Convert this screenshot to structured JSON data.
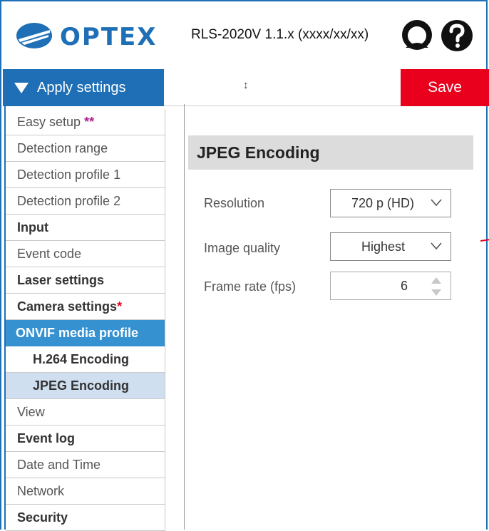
{
  "header": {
    "brand": "OPTEX",
    "version": "RLS-2020V 1.1.x (xxxx/xx/xx)",
    "user_icon": "user-icon",
    "help_icon": "help-icon"
  },
  "toolbar": {
    "apply_label": "Apply settings",
    "resize_glyph": "↕",
    "save_label": "Save"
  },
  "sidebar": {
    "items": [
      {
        "label": "Easy setup",
        "marker": "**"
      },
      {
        "label": "Detection range"
      },
      {
        "label": "Detection profile 1"
      },
      {
        "label": "Detection profile 2"
      },
      {
        "label": "Input"
      },
      {
        "label": "Event code"
      },
      {
        "label": "Laser settings"
      },
      {
        "label": "Camera settings",
        "marker": "*"
      },
      {
        "label": "ONVIF media profile"
      },
      {
        "label": "H.264 Encoding"
      },
      {
        "label": "JPEG Encoding"
      },
      {
        "label": "View"
      },
      {
        "label": "Event log"
      },
      {
        "label": "Date and Time"
      },
      {
        "label": "Network"
      },
      {
        "label": "Security"
      }
    ]
  },
  "main": {
    "title": "JPEG Encoding",
    "resolution": {
      "label": "Resolution",
      "value": "720 p (HD)"
    },
    "quality": {
      "label": "Image quality",
      "value": "Highest"
    },
    "framerate": {
      "label": "Frame rate (fps)",
      "value": "6"
    }
  },
  "colors": {
    "brand_blue": "#1e6fb6",
    "active_blue": "#3591d0",
    "save_red": "#e8001c",
    "selected_bg": "#cfdff0"
  }
}
